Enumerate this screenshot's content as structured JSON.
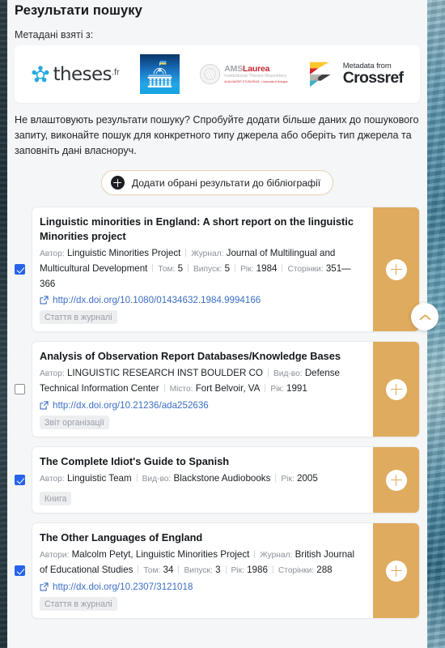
{
  "page": {
    "title": "Результати пошуку",
    "metadata_label": "Метаданi взятi з:",
    "hint": "Не влаштовують результати пошуку? Спробуйте додати більше даних до пошукового запиту, виконайте пошук для конкретного типу джерела або оберіть тип джерела та заповніть дані власноруч."
  },
  "sources": [
    {
      "name": "theses-fr-logo",
      "word": "theses",
      "sup": ".fr"
    },
    {
      "name": "rada-library-logo",
      "word": "",
      "sup": ""
    },
    {
      "name": "amslaurea-logo",
      "t1_a": "AMS",
      "t1_b": "Laurea",
      "t2": "Institutional Theses Repository",
      "t3": "ALMA MATER STUDIORUM · Università di Bologna"
    },
    {
      "name": "crossref-logo",
      "t1": "Metadata from",
      "t2": "Crossref"
    }
  ],
  "add_selected": {
    "label": "Додати обрані результати до бібліографії",
    "icon": "plus-circle-icon"
  },
  "scroll_top": {
    "icon": "chevron-up-icon",
    "accent": "#dfab5f"
  },
  "colors": {
    "accent_orange": "#dfab5f",
    "checkbox_blue": "#2563eb",
    "link_blue": "#3c6fc4",
    "page_bg": "#f5f6f7",
    "card_bg": "#ffffff"
  },
  "results": [
    {
      "checked": true,
      "title": "Linguistic minorities in England: A short report on the linguistic Minorities project",
      "fields": [
        {
          "label": "Автор:",
          "value": "Linguistic Minorities Project"
        },
        {
          "label": "Журнал:",
          "value": "Journal of Multilingual and Multicultural Development"
        },
        {
          "label": "Том:",
          "value": "5"
        },
        {
          "label": "Випуск:",
          "value": "5"
        },
        {
          "label": "Рік:",
          "value": "1984"
        },
        {
          "label": "Сторінки:",
          "value": "351—366"
        }
      ],
      "link": "http://dx.doi.org/10.1080/01434632.1984.9994166",
      "tag": "Стаття в журналі",
      "action_label": "+"
    },
    {
      "checked": false,
      "title": "Analysis of Observation Report Databases/Knowledge Bases",
      "fields": [
        {
          "label": "Автор:",
          "value": "LINGUISTIC RESEARCH INST BOULDER CO"
        },
        {
          "label": "Вид-во:",
          "value": "Defense Technical Information Center"
        },
        {
          "label": "Місто:",
          "value": "Fort Belvoir, VA"
        },
        {
          "label": "Рік:",
          "value": "1991"
        }
      ],
      "link": "http://dx.doi.org/10.21236/ada252636",
      "tag": "Звіт організації",
      "action_label": "+"
    },
    {
      "checked": true,
      "title": "The Complete Idiot's Guide to Spanish",
      "fields": [
        {
          "label": "Автор:",
          "value": "Linguistic Team"
        },
        {
          "label": "Вид-во:",
          "value": "Blackstone Audiobooks"
        },
        {
          "label": "Рік:",
          "value": "2005"
        }
      ],
      "link": "",
      "tag": "Книга",
      "action_label": "+"
    },
    {
      "checked": true,
      "title": "The Other Languages of England",
      "fields": [
        {
          "label": "Автори:",
          "value": "Malcolm Petyt, Linguistic Minorities Project"
        },
        {
          "label": "Журнал:",
          "value": "British Journal of Educational Studies"
        },
        {
          "label": "Том:",
          "value": "34"
        },
        {
          "label": "Випуск:",
          "value": "3"
        },
        {
          "label": "Рік:",
          "value": "1986"
        },
        {
          "label": "Сторінки:",
          "value": "288"
        }
      ],
      "link": "http://dx.doi.org/10.2307/3121018",
      "tag": "Стаття в журналі",
      "action_label": "+"
    }
  ]
}
